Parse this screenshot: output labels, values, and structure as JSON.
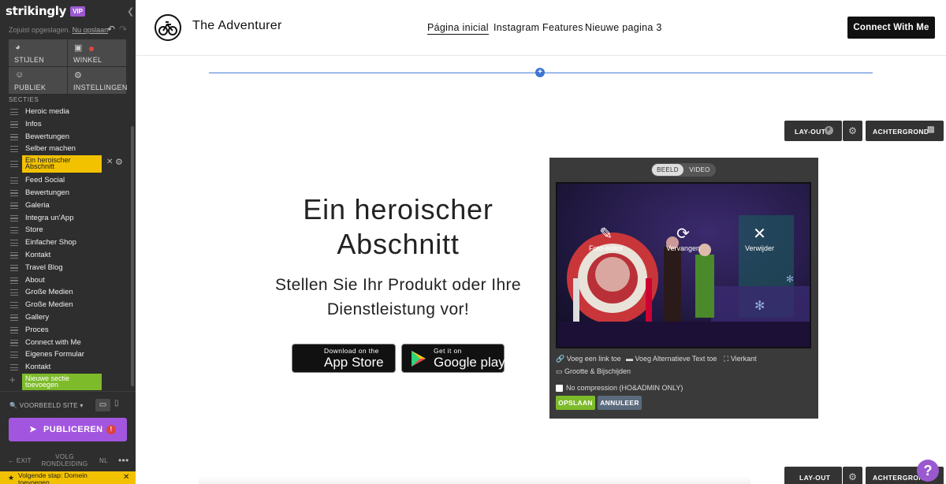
{
  "sidebar": {
    "logo": "strikingly",
    "vip": "VIP",
    "saved_status": "Zojuist opgeslagen.",
    "save_now": "Nu opslaan",
    "tiles": [
      {
        "label": "STIJLEN",
        "icon": "palette-icon"
      },
      {
        "label": "WINKEL",
        "icon": "shopping-bag-icon"
      },
      {
        "label": "PUBLIEK",
        "icon": "people-icon"
      },
      {
        "label": "INSTELLINGEN",
        "icon": "gear-icon"
      }
    ],
    "sections_heading": "SECTIES",
    "sections": [
      "Heroic media",
      "Infos",
      "Bewertungen",
      "Selber machen",
      "Ein heroischer Abschnitt",
      "Feed Social",
      "Bewertungen",
      "Galeria",
      "Integra un'App",
      "Store",
      "Einfacher Shop",
      "Kontakt",
      "Travel Blog",
      "About",
      "Große Medien",
      "Große Medien",
      "Gallery",
      "Proces",
      "Connect with Me",
      "Eigenes Formular",
      "Kontakt"
    ],
    "active_section": "Ein heroischer Abschnitt",
    "new_section": "Nieuwe sectie toevoegen",
    "preview_site": "VOORBEELD SITE",
    "publish": "PUBLICEREN",
    "publish_alert": "!",
    "exit": "EXIT",
    "tour": "VOLG RONDLEIDING",
    "language": "NL",
    "next_step": "Volgende stap: Domein toevoegen"
  },
  "site": {
    "title": "The Adventurer",
    "nav": [
      "Página inicial",
      "Instagram Features",
      "Nieuwe pagina 3"
    ],
    "cta": "Connect With Me"
  },
  "section_controls": {
    "layout": "LAY-OUT",
    "layout_badge": "F",
    "background": "ACHTERGROND"
  },
  "hero": {
    "title": "Ein heroischer Abschnitt",
    "subtitle": "Stellen Sie Ihr Produkt oder Ihre Dienstleistung vor!",
    "app_store_small": "Download on the",
    "app_store_big": "App Store",
    "google_play_small": "Get it on",
    "google_play_big": "Google play"
  },
  "media_editor": {
    "tab_image": "BEELD",
    "tab_video": "VIDEO",
    "photo_editor": "Foto-editor",
    "replace": "Vervangen",
    "remove": "Verwijder",
    "add_link": "Voeg een link toe",
    "add_alt": "Voeg Alternatieve Text toe",
    "square": "Vierkant",
    "size_captions": "Grootte & Bijschijden",
    "no_compression": "No compression (HO&ADMIN ONLY)",
    "save": "OPSLAAN",
    "cancel": "ANNULEER"
  },
  "help": "?",
  "colors": {
    "sidebar_bg": "#2e2e2e",
    "active_section": "#f2c200",
    "new_section": "#7dbb2a",
    "publish": "#a256e0",
    "save": "#7dbb2a",
    "cancel": "#5a6b7d",
    "divider": "#4a7fd6"
  }
}
